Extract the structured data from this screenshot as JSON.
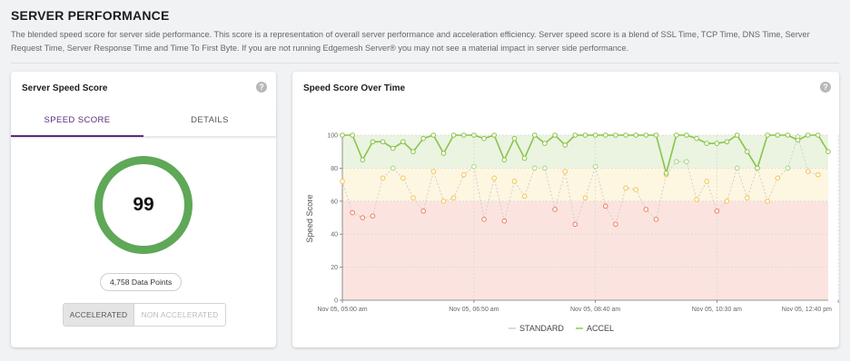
{
  "header": {
    "title": "SERVER PERFORMANCE",
    "description": "The blended speed score for server side performance. This score is a representation of overall server performance and acceleration efficiency. Server speed score is a blend of SSL Time, TCP Time, DNS Time, Server Request Time, Server Response Time and Time To First Byte. If you are not running Edgemesh Server® you may not see a material impact in server side performance."
  },
  "left_card": {
    "title": "Server Speed Score",
    "help": "?",
    "tabs": [
      "SPEED SCORE",
      "DETAILS"
    ],
    "active_tab": "SPEED SCORE",
    "score": "99",
    "score_fraction": 0.99,
    "data_points": "4,758 Data Points",
    "toggle": {
      "on": "ACCELERATED",
      "off": "NON ACCELERATED"
    }
  },
  "right_card": {
    "title": "Speed Score Over Time",
    "help": "?"
  },
  "colors": {
    "accent": "#5b2c7d",
    "gauge": "#5ea857",
    "accel": "#8bc34a",
    "standard_mid": "#f6c24a",
    "standard_low": "#ee7a5a",
    "band_green": "#eaf4e1",
    "band_yellow": "#fdf6e1",
    "band_red": "#fbe4df"
  },
  "chart_data": {
    "type": "line",
    "title": "",
    "xlabel": "",
    "ylabel": "Speed Score",
    "ylim": [
      0,
      100
    ],
    "yticks": [
      0,
      20,
      40,
      60,
      80,
      100
    ],
    "xticks": [
      "Nov 05, 05:00 am",
      "Nov 05, 06:50 am",
      "Nov 05, 08:40 am",
      "Nov 05, 10:30 am",
      "Nov 05, 12:40 pm"
    ],
    "xtick_index": [
      0,
      13,
      25,
      37,
      49
    ],
    "bands": [
      {
        "from": 80,
        "to": 100,
        "color": "band_green"
      },
      {
        "from": 60,
        "to": 80,
        "color": "band_yellow"
      },
      {
        "from": 0,
        "to": 60,
        "color": "band_red"
      }
    ],
    "legend": {
      "position": "bottom-center"
    },
    "series": [
      {
        "name": "STANDARD",
        "color": "#cccccc",
        "values": [
          72,
          53,
          50,
          51,
          74,
          80,
          74,
          62,
          54,
          78,
          60,
          62,
          76,
          81,
          49,
          74,
          48,
          72,
          63,
          80,
          80,
          55,
          78,
          46,
          62,
          81,
          57,
          46,
          68,
          67,
          55,
          49,
          76,
          84,
          84,
          61,
          72,
          54,
          60,
          80,
          62,
          80,
          60,
          74,
          80,
          99,
          78,
          76
        ]
      },
      {
        "name": "ACCEL",
        "color": "#8bc34a",
        "values": [
          100,
          100,
          85,
          96,
          96,
          92,
          96,
          90,
          98,
          100,
          89,
          100,
          100,
          100,
          98,
          100,
          85,
          98,
          86,
          100,
          95,
          100,
          94,
          100,
          100,
          100,
          100,
          100,
          100,
          100,
          100,
          100,
          77,
          100,
          100,
          98,
          95,
          95,
          96,
          100,
          90,
          80,
          100,
          100,
          100,
          97,
          100,
          100,
          90
        ]
      }
    ]
  }
}
